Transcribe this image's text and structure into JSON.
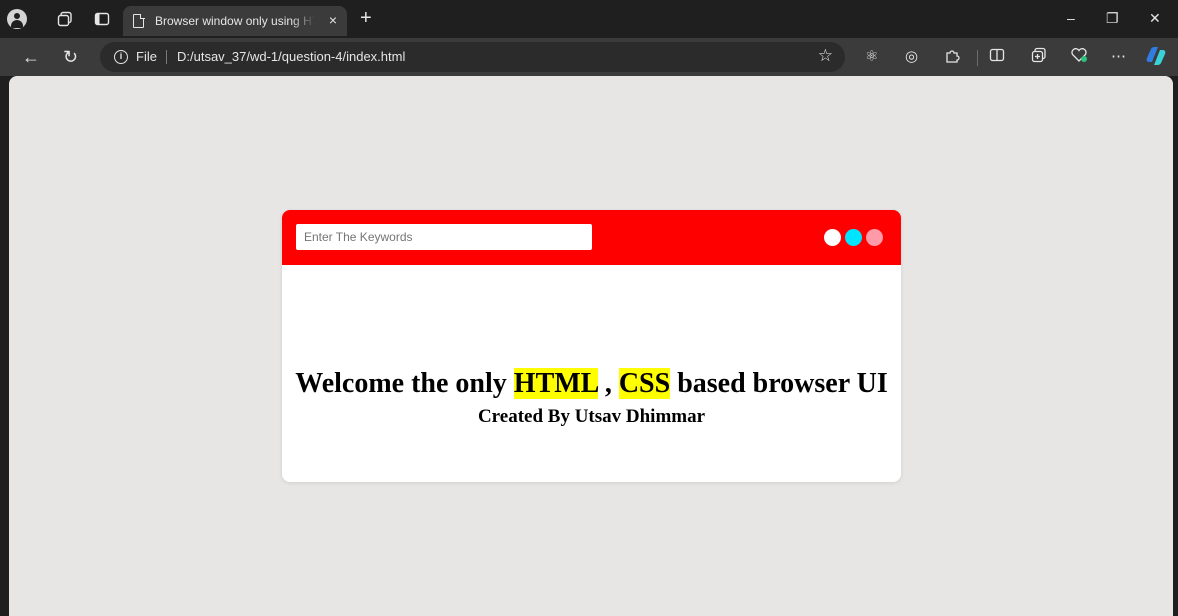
{
  "browser": {
    "tab": {
      "title": "Browser window only using HTML & CSS",
      "close": "×"
    },
    "new_tab": "+",
    "window_controls": {
      "minimize": "–",
      "restore": "❐",
      "close": "✕"
    },
    "address": {
      "scheme_label": "File",
      "url": "D:/utsav_37/wd-1/question-4/index.html"
    },
    "toolbar_icons": [
      "back-icon",
      "refresh-icon",
      "favorites-star-icon",
      "extension-atom-icon",
      "browser-essentials-icon",
      "extensions-icon",
      "split-screen-icon",
      "collections-icon",
      "performance-heart-icon",
      "more-options-icon",
      "copilot-icon"
    ]
  },
  "page": {
    "search": {
      "placeholder": "Enter The Keywords",
      "value": ""
    },
    "dots": [
      {
        "name": "white",
        "color": "#ffffff"
      },
      {
        "name": "cyan",
        "color": "#00e5ff"
      },
      {
        "name": "pink",
        "color": "#ff9aa8"
      }
    ],
    "welcome": {
      "part1": "Welcome the only ",
      "html": "HTML",
      "part2": " , ",
      "css": "CSS",
      "part3": " based browser UI"
    },
    "credit": "Created By Utsav Dhimmar"
  },
  "colors": {
    "header": "#ff0000",
    "highlight": "#ffff00",
    "viewport": "#e8e6e5"
  }
}
